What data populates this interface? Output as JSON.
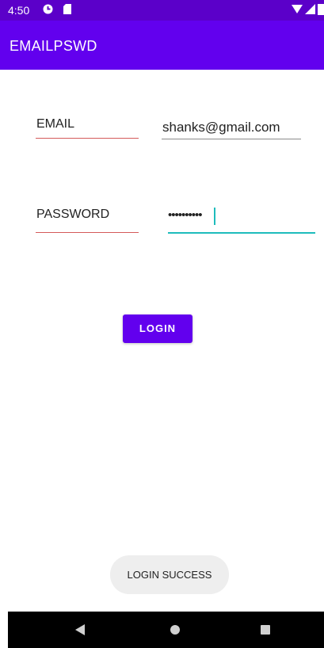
{
  "status_bar": {
    "time": "4:50",
    "icons": [
      "data-saver-icon",
      "sd-card-icon",
      "wifi-icon",
      "signal-icon",
      "battery-icon"
    ]
  },
  "app_bar": {
    "title": "EMAILPSWD"
  },
  "form": {
    "email_label": "EMAIL",
    "email_value": "shanks@gmail.com",
    "password_label": "PASSWORD",
    "password_value": "••••••••••",
    "login_button": "LOGIN"
  },
  "toast": {
    "message": "LOGIN SUCCESS"
  },
  "nav_bar": {
    "icons": [
      "back-icon",
      "home-icon",
      "recents-icon"
    ]
  },
  "colors": {
    "status_bar": "#5b00c9",
    "app_bar": "#6200ee",
    "button": "#6200ee",
    "label_underline": "#d45a5a",
    "active_underline": "#1ebcbc",
    "toast_bg": "#eeeeee",
    "nav_bar": "#000000"
  }
}
